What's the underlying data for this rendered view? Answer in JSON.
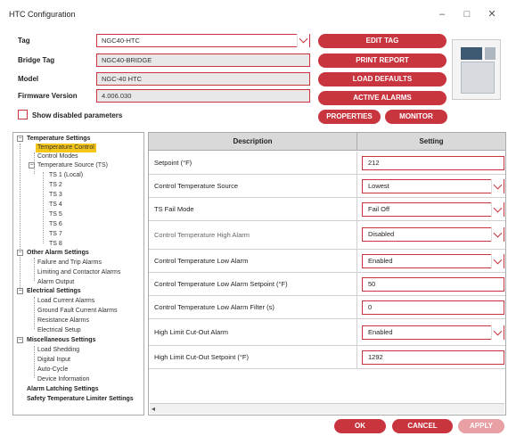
{
  "window": {
    "title": "HTC Configuration",
    "minimize_glyph": "–",
    "maximize_glyph": "□",
    "close_glyph": "✕"
  },
  "form": {
    "tag_label": "Tag",
    "tag_value": "NGC40-HTC",
    "bridge_tag_label": "Bridge Tag",
    "bridge_tag_value": "NGC40-BRIDGE",
    "model_label": "Model",
    "model_value": "NGC-40 HTC",
    "firmware_label": "Firmware Version",
    "firmware_value": "4.006.030",
    "show_disabled_label": "Show disabled parameters"
  },
  "actions": {
    "edit_tag": "EDIT TAG",
    "print_report": "PRINT REPORT",
    "load_defaults": "LOAD DEFAULTS",
    "active_alarms": "ACTIVE ALARMS",
    "properties": "PROPERTIES",
    "monitor": "MONITOR"
  },
  "tree": {
    "temperature_settings": "Temperature Settings",
    "temperature_control": "Temperature Control",
    "control_modes": "Control Modes",
    "temperature_source": "Temperature Source (TS)",
    "ts1": "TS 1 (Local)",
    "ts2": "TS 2",
    "ts3": "TS 3",
    "ts4": "TS 4",
    "ts5": "TS 5",
    "ts6": "TS 6",
    "ts7": "TS 7",
    "ts8": "TS 8",
    "other_alarm_settings": "Other Alarm Settings",
    "failure_trip": "Failure and Trip Alarms",
    "limiting_contactor": "Limiting and Contactor Alarms",
    "alarm_output": "Alarm Output",
    "electrical_settings": "Electrical Settings",
    "load_current": "Load Current Alarms",
    "ground_fault": "Ground Fault Current Alarms",
    "resistance": "Resistance Alarms",
    "electrical_setup": "Electrical Setup",
    "misc_settings": "Miscellaneous Settings",
    "load_shedding": "Load Shedding",
    "digital_input": "Digital Input",
    "auto_cycle": "Auto-Cycle",
    "device_info": "Device Information",
    "alarm_latching": "Alarm Latching Settings",
    "safety_temp": "Safety Temperature Limiter Settings",
    "expanded_glyph": "−"
  },
  "grid": {
    "headers": {
      "description": "Description",
      "setting": "Setting"
    },
    "rows": [
      {
        "description": "Setpoint (°F)",
        "value": "212"
      },
      {
        "description": "Control Temperature Source",
        "value": "Lowest"
      },
      {
        "description": "TS Fail Mode",
        "value": "Fail Off"
      },
      {
        "description": "Control Temperature High Alarm",
        "value": "Disabled"
      },
      {
        "description": "Control Temperature Low Alarm",
        "value": "Enabled"
      },
      {
        "description": "Control Temperature Low Alarm Setpoint (°F)",
        "value": "50"
      },
      {
        "description": "Control Temperature Low Alarm Filter (s)",
        "value": "0"
      },
      {
        "description": "High Limit Cut-Out Alarm",
        "value": "Enabled"
      },
      {
        "description": "High Limit Cut-Out Setpoint (°F)",
        "value": "1292"
      }
    ],
    "scroll_left_glyph": "◂"
  },
  "footer": {
    "ok": "OK",
    "cancel": "CANCEL",
    "apply": "APPLY"
  },
  "colors": {
    "accent": "#c9353f",
    "apply_disabled": "#e9a0a5",
    "selection": "#f5c518"
  }
}
